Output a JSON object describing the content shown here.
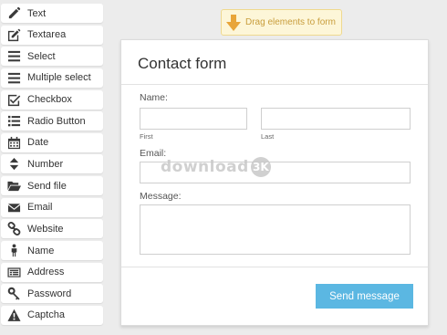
{
  "palette": {
    "items": [
      {
        "label": "Text",
        "icon": "pencil-icon"
      },
      {
        "label": "Textarea",
        "icon": "edit-icon"
      },
      {
        "label": "Select",
        "icon": "lines-icon"
      },
      {
        "label": "Multiple select",
        "icon": "lines-icon"
      },
      {
        "label": "Checkbox",
        "icon": "checkbox-icon"
      },
      {
        "label": "Radio Button",
        "icon": "list-icon"
      },
      {
        "label": "Date",
        "icon": "calendar-icon"
      },
      {
        "label": "Number",
        "icon": "sort-icon"
      },
      {
        "label": "Send file",
        "icon": "folder-open-icon"
      },
      {
        "label": "Email",
        "icon": "envelope-icon"
      },
      {
        "label": "Website",
        "icon": "link-icon"
      },
      {
        "label": "Name",
        "icon": "person-icon"
      },
      {
        "label": "Address",
        "icon": "address-card-icon"
      },
      {
        "label": "Password",
        "icon": "key-icon"
      },
      {
        "label": "Captcha",
        "icon": "warning-icon"
      }
    ]
  },
  "hint": {
    "label": "Drag elements to form",
    "icon": "arrow-down-icon"
  },
  "form": {
    "title": "Contact form",
    "name_label": "Name:",
    "first_sublabel": "First",
    "last_sublabel": "Last",
    "email_label": "Email:",
    "message_label": "Message:",
    "submit_label": "Send message"
  },
  "watermark": {
    "text": "download",
    "logo": "3K"
  },
  "colors": {
    "background": "#ececec",
    "submit_button": "#5bb7e2",
    "hint_background": "#fdf6d8",
    "hint_text": "#c89d3c"
  }
}
